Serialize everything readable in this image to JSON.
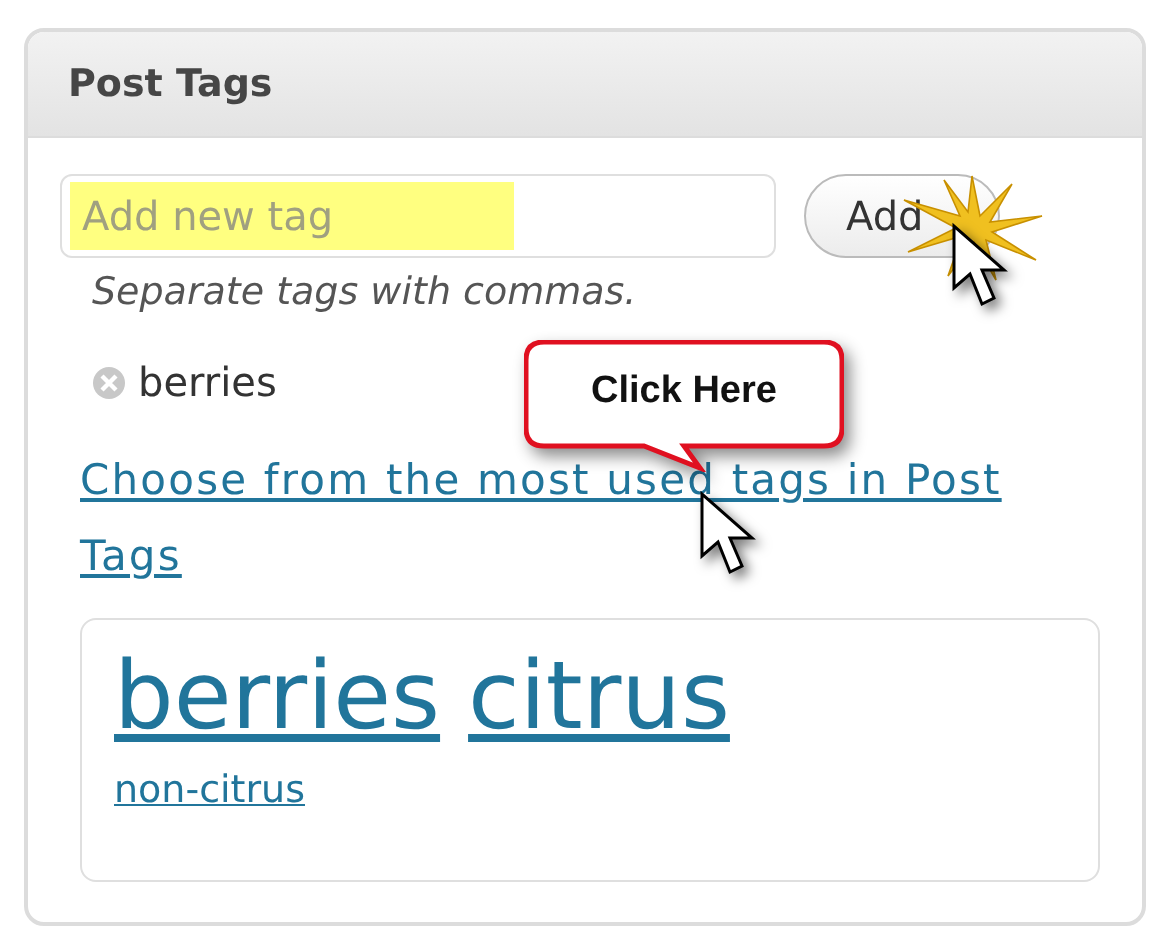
{
  "panel": {
    "title": "Post Tags"
  },
  "new_tag": {
    "placeholder": "Add new tag",
    "highlighted": true
  },
  "add_button": {
    "label": "Add"
  },
  "hint": "Separate tags with commas.",
  "added_tags": [
    {
      "label": "berries"
    }
  ],
  "callout": {
    "text": "Click Here"
  },
  "most_used_link": "Choose from the most used tags in Post Tags",
  "tag_cloud": [
    {
      "label": "berries",
      "kind": "large"
    },
    {
      "label": "citrus",
      "kind": "large"
    },
    {
      "label": "non-citrus",
      "kind": "small"
    }
  ]
}
